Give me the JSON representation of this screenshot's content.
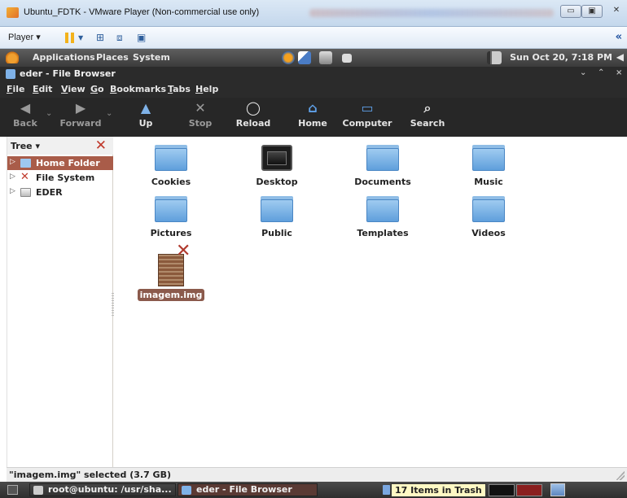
{
  "vmware": {
    "title": "Ubuntu_FDTK - VMware Player (Non-commercial use only)",
    "player_menu": "Player ▾",
    "collapse_glyph": "«",
    "min_glyph": "▭",
    "max_glyph": "▣",
    "close_glyph": "✕"
  },
  "panel": {
    "menus": [
      "Applications",
      "Places",
      "System"
    ],
    "clock": "Sun Oct 20,  7:18 PM"
  },
  "window": {
    "title": "eder - File Browser",
    "controls": [
      "⌄",
      "⌃",
      "×"
    ]
  },
  "menubar": [
    "File",
    "Edit",
    "View",
    "Go",
    "Bookmarks",
    "Tabs",
    "Help"
  ],
  "toolbar": {
    "buttons": [
      {
        "label": "Back",
        "icon": "back-arrow-icon",
        "enabled": false
      },
      {
        "label": "Forward",
        "icon": "forward-arrow-icon",
        "enabled": false
      },
      {
        "label": "Up",
        "icon": "up-arrow-icon",
        "enabled": true
      },
      {
        "label": "Stop",
        "icon": "stop-icon",
        "enabled": false
      },
      {
        "label": "Reload",
        "icon": "reload-icon",
        "enabled": true
      },
      {
        "label": "Home",
        "icon": "home-icon",
        "enabled": true
      },
      {
        "label": "Computer",
        "icon": "computer-icon",
        "enabled": true
      },
      {
        "label": "Search",
        "icon": "search-icon",
        "enabled": true
      }
    ]
  },
  "sidebar": {
    "header": "Tree ▾",
    "items": [
      {
        "label": "Home Folder",
        "selected": true,
        "icon": "home-folder-icon"
      },
      {
        "label": "File System",
        "selected": false,
        "icon": "filesystem-icon"
      },
      {
        "label": "EDER",
        "selected": false,
        "icon": "drive-icon"
      }
    ]
  },
  "files": [
    {
      "label": "Cookies",
      "type": "folder"
    },
    {
      "label": "Desktop",
      "type": "desktop"
    },
    {
      "label": "Documents",
      "type": "folder"
    },
    {
      "label": "Music",
      "type": "folder"
    },
    {
      "label": "Pictures",
      "type": "folder"
    },
    {
      "label": "Public",
      "type": "folder"
    },
    {
      "label": "Templates",
      "type": "folder"
    },
    {
      "label": "Videos",
      "type": "folder"
    },
    {
      "label": "imagem.img",
      "type": "image",
      "selected": true
    }
  ],
  "status": {
    "text": "\"imagem.img\" selected (3.7 GB)"
  },
  "taskbar": {
    "tasks": [
      {
        "label": "root@ubuntu: /usr/sha..."
      },
      {
        "label": "eder - File Browser"
      }
    ],
    "trash_tip": "17 Items in Trash"
  }
}
